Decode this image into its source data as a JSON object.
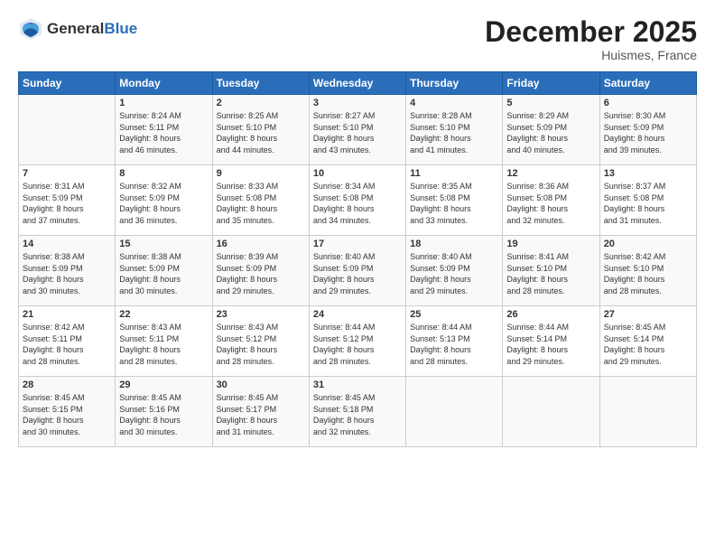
{
  "header": {
    "logo_general": "General",
    "logo_blue": "Blue",
    "month_title": "December 2025",
    "location": "Huismes, France"
  },
  "days_of_week": [
    "Sunday",
    "Monday",
    "Tuesday",
    "Wednesday",
    "Thursday",
    "Friday",
    "Saturday"
  ],
  "weeks": [
    [
      {
        "day": "",
        "info": ""
      },
      {
        "day": "1",
        "info": "Sunrise: 8:24 AM\nSunset: 5:11 PM\nDaylight: 8 hours\nand 46 minutes."
      },
      {
        "day": "2",
        "info": "Sunrise: 8:25 AM\nSunset: 5:10 PM\nDaylight: 8 hours\nand 44 minutes."
      },
      {
        "day": "3",
        "info": "Sunrise: 8:27 AM\nSunset: 5:10 PM\nDaylight: 8 hours\nand 43 minutes."
      },
      {
        "day": "4",
        "info": "Sunrise: 8:28 AM\nSunset: 5:10 PM\nDaylight: 8 hours\nand 41 minutes."
      },
      {
        "day": "5",
        "info": "Sunrise: 8:29 AM\nSunset: 5:09 PM\nDaylight: 8 hours\nand 40 minutes."
      },
      {
        "day": "6",
        "info": "Sunrise: 8:30 AM\nSunset: 5:09 PM\nDaylight: 8 hours\nand 39 minutes."
      }
    ],
    [
      {
        "day": "7",
        "info": "Sunrise: 8:31 AM\nSunset: 5:09 PM\nDaylight: 8 hours\nand 37 minutes."
      },
      {
        "day": "8",
        "info": "Sunrise: 8:32 AM\nSunset: 5:09 PM\nDaylight: 8 hours\nand 36 minutes."
      },
      {
        "day": "9",
        "info": "Sunrise: 8:33 AM\nSunset: 5:08 PM\nDaylight: 8 hours\nand 35 minutes."
      },
      {
        "day": "10",
        "info": "Sunrise: 8:34 AM\nSunset: 5:08 PM\nDaylight: 8 hours\nand 34 minutes."
      },
      {
        "day": "11",
        "info": "Sunrise: 8:35 AM\nSunset: 5:08 PM\nDaylight: 8 hours\nand 33 minutes."
      },
      {
        "day": "12",
        "info": "Sunrise: 8:36 AM\nSunset: 5:08 PM\nDaylight: 8 hours\nand 32 minutes."
      },
      {
        "day": "13",
        "info": "Sunrise: 8:37 AM\nSunset: 5:08 PM\nDaylight: 8 hours\nand 31 minutes."
      }
    ],
    [
      {
        "day": "14",
        "info": "Sunrise: 8:38 AM\nSunset: 5:09 PM\nDaylight: 8 hours\nand 30 minutes."
      },
      {
        "day": "15",
        "info": "Sunrise: 8:38 AM\nSunset: 5:09 PM\nDaylight: 8 hours\nand 30 minutes."
      },
      {
        "day": "16",
        "info": "Sunrise: 8:39 AM\nSunset: 5:09 PM\nDaylight: 8 hours\nand 29 minutes."
      },
      {
        "day": "17",
        "info": "Sunrise: 8:40 AM\nSunset: 5:09 PM\nDaylight: 8 hours\nand 29 minutes."
      },
      {
        "day": "18",
        "info": "Sunrise: 8:40 AM\nSunset: 5:09 PM\nDaylight: 8 hours\nand 29 minutes."
      },
      {
        "day": "19",
        "info": "Sunrise: 8:41 AM\nSunset: 5:10 PM\nDaylight: 8 hours\nand 28 minutes."
      },
      {
        "day": "20",
        "info": "Sunrise: 8:42 AM\nSunset: 5:10 PM\nDaylight: 8 hours\nand 28 minutes."
      }
    ],
    [
      {
        "day": "21",
        "info": "Sunrise: 8:42 AM\nSunset: 5:11 PM\nDaylight: 8 hours\nand 28 minutes."
      },
      {
        "day": "22",
        "info": "Sunrise: 8:43 AM\nSunset: 5:11 PM\nDaylight: 8 hours\nand 28 minutes."
      },
      {
        "day": "23",
        "info": "Sunrise: 8:43 AM\nSunset: 5:12 PM\nDaylight: 8 hours\nand 28 minutes."
      },
      {
        "day": "24",
        "info": "Sunrise: 8:44 AM\nSunset: 5:12 PM\nDaylight: 8 hours\nand 28 minutes."
      },
      {
        "day": "25",
        "info": "Sunrise: 8:44 AM\nSunset: 5:13 PM\nDaylight: 8 hours\nand 28 minutes."
      },
      {
        "day": "26",
        "info": "Sunrise: 8:44 AM\nSunset: 5:14 PM\nDaylight: 8 hours\nand 29 minutes."
      },
      {
        "day": "27",
        "info": "Sunrise: 8:45 AM\nSunset: 5:14 PM\nDaylight: 8 hours\nand 29 minutes."
      }
    ],
    [
      {
        "day": "28",
        "info": "Sunrise: 8:45 AM\nSunset: 5:15 PM\nDaylight: 8 hours\nand 30 minutes."
      },
      {
        "day": "29",
        "info": "Sunrise: 8:45 AM\nSunset: 5:16 PM\nDaylight: 8 hours\nand 30 minutes."
      },
      {
        "day": "30",
        "info": "Sunrise: 8:45 AM\nSunset: 5:17 PM\nDaylight: 8 hours\nand 31 minutes."
      },
      {
        "day": "31",
        "info": "Sunrise: 8:45 AM\nSunset: 5:18 PM\nDaylight: 8 hours\nand 32 minutes."
      },
      {
        "day": "",
        "info": ""
      },
      {
        "day": "",
        "info": ""
      },
      {
        "day": "",
        "info": ""
      }
    ]
  ]
}
